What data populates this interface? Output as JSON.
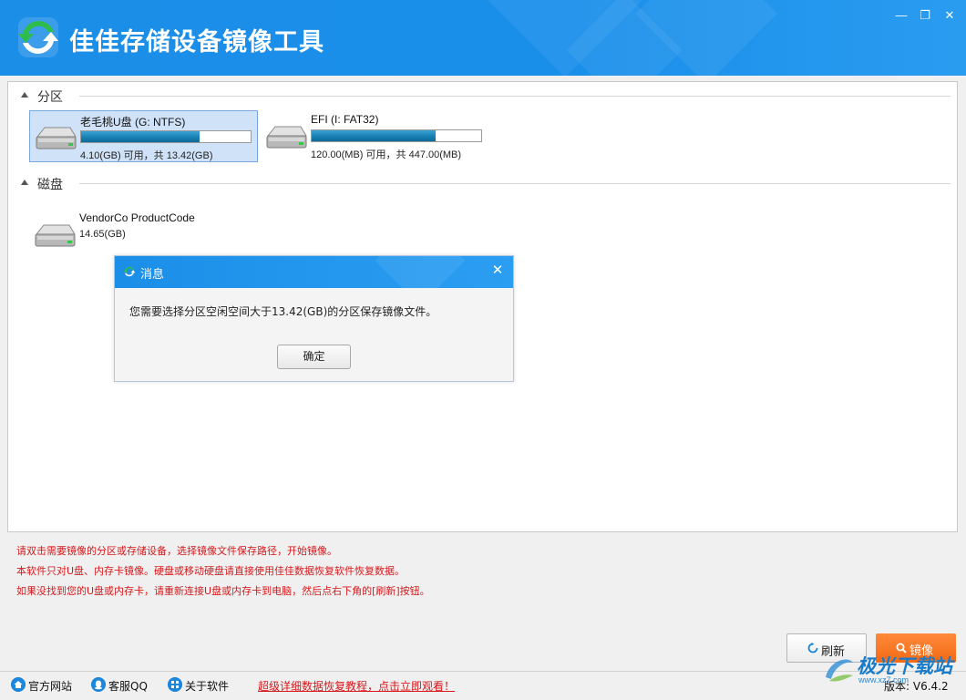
{
  "app": {
    "title": "佳佳存储设备镜像工具"
  },
  "window": {
    "minimize_glyph": "—",
    "maximize_glyph": "❐",
    "close_glyph": "✕"
  },
  "partitions": {
    "title": "分区",
    "items": [
      {
        "name": "老毛桃U盘 (G: NTFS)",
        "info": "4.10(GB) 可用，共 13.42(GB)",
        "used_fraction": 0.7,
        "selected": true
      },
      {
        "name": "EFI (I: FAT32)",
        "info": "120.00(MB) 可用，共 447.00(MB)",
        "used_fraction": 0.73,
        "selected": false
      }
    ]
  },
  "disks": {
    "title": "磁盘",
    "items": [
      {
        "name": "VendorCo ProductCode",
        "info": "14.65(GB)"
      }
    ]
  },
  "dialog": {
    "title": "消息",
    "message": "您需要选择分区空闲空间大于13.42(GB)的分区保存镜像文件。",
    "ok_label": "确定"
  },
  "hints": [
    "请双击需要镜像的分区或存储设备，选择镜像文件保存路径，开始镜像。",
    "本软件只对U盘、内存卡镜像。硬盘或移动硬盘请直接使用佳佳数据恢复软件恢复数据。",
    "如果没找到您的U盘或内存卡，请重新连接U盘或内存卡到电脑，然后点右下角的[刷新]按钮。"
  ],
  "buttons": {
    "refresh": "刷新",
    "mirror": "镜像"
  },
  "footer": {
    "links": [
      {
        "label": "官方网站",
        "icon": "home-icon"
      },
      {
        "label": "客服QQ",
        "icon": "qq-icon"
      },
      {
        "label": "关于软件",
        "icon": "info-icon"
      }
    ],
    "promo": "超级详细数据恢复教程，点击立即观看！",
    "version": "版本: V6.4.2"
  },
  "watermark": {
    "text": "极光下载站",
    "sub": "www.xz7.com"
  },
  "colors": {
    "accent": "#1b8ee8",
    "orange": "#f26a14",
    "hint_red": "#d7191c",
    "selected_bg": "#cfe2f8"
  }
}
